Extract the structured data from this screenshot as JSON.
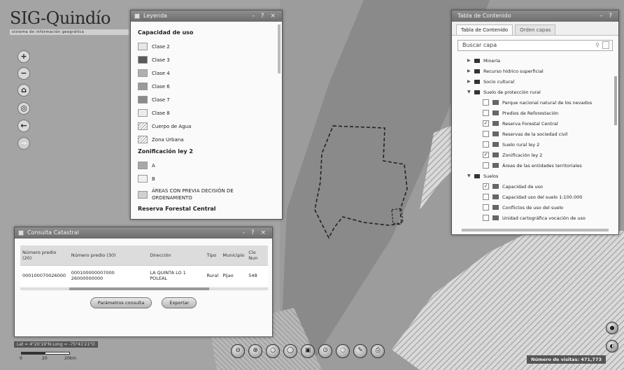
{
  "logo": {
    "title": "SIG-Quindío",
    "subtitle": "sistema de información geográfica"
  },
  "map_tools": [
    {
      "name": "zoom-in-button",
      "icon": "+"
    },
    {
      "name": "zoom-out-button",
      "icon": "−"
    },
    {
      "name": "home-button",
      "icon": "⌂"
    },
    {
      "name": "locate-button",
      "icon": "◎"
    },
    {
      "name": "back-button",
      "icon": "←"
    },
    {
      "name": "forward-button",
      "icon": "→"
    }
  ],
  "legend": {
    "title": "Leyenda",
    "controls": "- ? ×",
    "sections": [
      {
        "title": "Capacidad de uso",
        "items": [
          {
            "label": "Clase 2",
            "color": "#e6e6e6"
          },
          {
            "label": "Clase 3",
            "color": "#5a5a5a"
          },
          {
            "label": "Clase 4",
            "color": "#b0b0b0"
          },
          {
            "label": "Clase 6",
            "color": "#9a9a9a"
          },
          {
            "label": "Clase 7",
            "color": "#8a8a8a"
          },
          {
            "label": "Clase 8",
            "color": "#ececec"
          },
          {
            "label": "Cuerpo de Agua",
            "color": "hatch"
          },
          {
            "label": "Zona Urbana",
            "color": "hatch"
          }
        ]
      },
      {
        "title": "Zonificación ley 2",
        "items": [
          {
            "label": "A",
            "color": "#a8a8a8"
          },
          {
            "label": "B",
            "color": "#f0f0f0"
          },
          {
            "label": "ÁREAS CON PREVIA DECISIÓN DE ORDENAMIENTO",
            "color": "#d0d0d0"
          }
        ]
      },
      {
        "title": "Reserva Forestal Central",
        "items": []
      }
    ]
  },
  "toc": {
    "title": "Tabla de Contenido",
    "tabs": [
      "Tabla de Contenido",
      "Orden capas"
    ],
    "search_placeholder": "Buscar capa",
    "nodes": [
      {
        "level": 0,
        "type": "folder",
        "label": "Minería"
      },
      {
        "level": 0,
        "type": "folder",
        "label": "Recurso hídrico superficial"
      },
      {
        "level": 0,
        "type": "folder",
        "label": "Socio cultural"
      },
      {
        "level": 0,
        "type": "folder-open",
        "label": "Suelo de protección rural"
      },
      {
        "level": 1,
        "type": "layer",
        "checked": false,
        "label": "Parque nacional natural de los nevados"
      },
      {
        "level": 1,
        "type": "layer",
        "checked": false,
        "label": "Predios de Reforestación"
      },
      {
        "level": 1,
        "type": "layer",
        "checked": true,
        "label": "Reserva Forestal Central"
      },
      {
        "level": 1,
        "type": "layer",
        "checked": false,
        "label": "Reservas de la sociedad civil"
      },
      {
        "level": 1,
        "type": "layer",
        "checked": false,
        "label": "Suelo rural ley 2"
      },
      {
        "level": 1,
        "type": "layer",
        "checked": true,
        "label": "Zonificación ley 2"
      },
      {
        "level": 1,
        "type": "layer",
        "checked": false,
        "label": "Áreas de las entidades territoriales"
      },
      {
        "level": 0,
        "type": "folder-open",
        "label": "Suelos"
      },
      {
        "level": 1,
        "type": "layer",
        "checked": true,
        "label": "Capacidad de uso"
      },
      {
        "level": 1,
        "type": "layer",
        "checked": false,
        "label": "Capacidad uso del suelo 1:100.000"
      },
      {
        "level": 1,
        "type": "layer",
        "checked": false,
        "label": "Conflictos de uso del suelo"
      },
      {
        "level": 1,
        "type": "layer",
        "checked": false,
        "label": "Unidad cartográfica vocación de uso"
      }
    ]
  },
  "query": {
    "title": "Consulta Catastral",
    "controls": "- ? ×",
    "columns": [
      "Número predio (20)",
      "Número predio (30)",
      "Dirección",
      "Tipo",
      "Municipio",
      "Clo Nun"
    ],
    "rows": [
      [
        "000100070026000",
        "000100000007000 26000000000",
        "LA QUINTA LO 1 POLEAL",
        "Rural",
        "Pijao",
        "548"
      ]
    ],
    "buttons": [
      "Parámetros consulta",
      "Exportar"
    ]
  },
  "coords": "Lat = 4°20'19\"N Long = -75°41'21\"O",
  "scale": {
    "labels": [
      "0",
      "20",
      "20km"
    ]
  },
  "bottom_tools": [
    "⊖",
    "⊕",
    "○",
    "◯",
    "▣",
    "⊙",
    "◌",
    "✎",
    "⎙"
  ],
  "visits": {
    "label": "Número de visitas:",
    "value": "471,773"
  },
  "colors": {
    "map": "#9a9a9a",
    "panel_header": "#7a7a7a"
  }
}
